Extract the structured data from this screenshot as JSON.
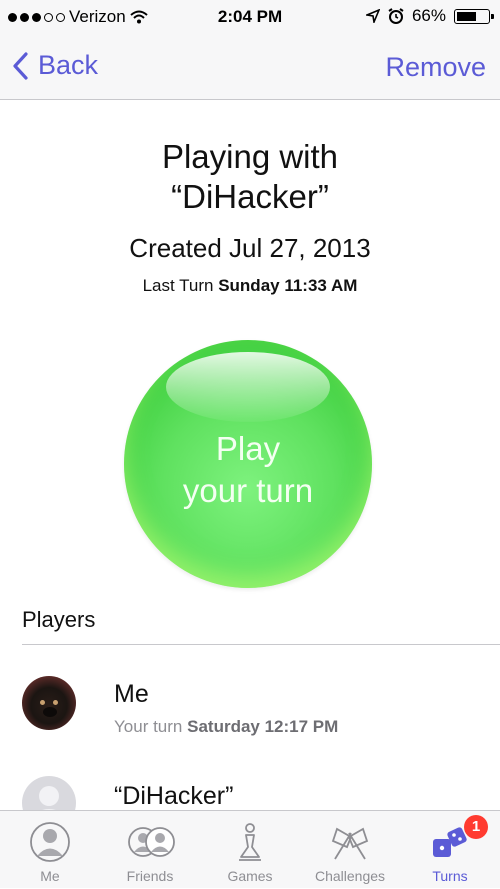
{
  "status_bar": {
    "carrier": "Verizon",
    "time": "2:04 PM",
    "battery": "66%",
    "battery_level": 0.66,
    "icons": [
      "signal-dots-icon",
      "wifi-icon",
      "location-icon",
      "alarm-icon",
      "battery-icon"
    ]
  },
  "nav": {
    "back_label": "Back",
    "remove_label": "Remove",
    "accent_color": "#5b5bd6"
  },
  "game": {
    "title_line1": "Playing with",
    "title_line2": "“DiHacker”",
    "created": "Created Jul 27, 2013",
    "last_turn_prefix": "Last Turn",
    "last_turn_value": "Sunday 11:33 AM",
    "play_line1": "Play",
    "play_line2": "your turn",
    "play_color": "#4fd64f"
  },
  "players": {
    "header": "Players",
    "list": [
      {
        "name": "Me",
        "sub_prefix": "Your turn",
        "sub_value": "Saturday 12:17 PM",
        "avatar": "dog-photo"
      },
      {
        "name": "“DiHacker”",
        "sub_prefix": "",
        "sub_value": "",
        "avatar": "generic-person-icon"
      }
    ]
  },
  "tabs": [
    {
      "label": "Me",
      "icon": "me-icon",
      "active": false
    },
    {
      "label": "Friends",
      "icon": "friends-icon",
      "active": false
    },
    {
      "label": "Games",
      "icon": "games-icon",
      "active": false
    },
    {
      "label": "Challenges",
      "icon": "challenges-icon",
      "active": false
    },
    {
      "label": "Turns",
      "icon": "turns-dice-icon",
      "active": true,
      "badge": "1"
    }
  ]
}
